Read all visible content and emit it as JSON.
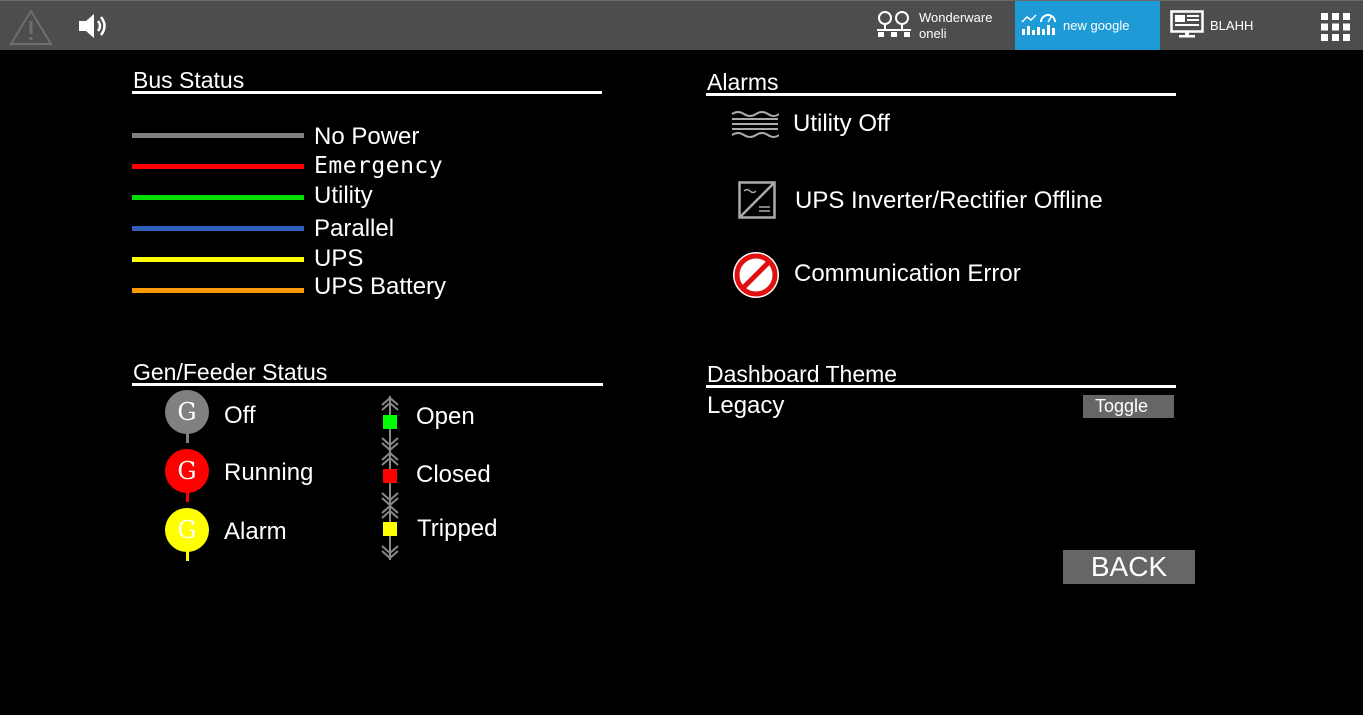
{
  "topbar": {
    "alarm_icon": "warning-triangle-icon",
    "speaker_icon": "speaker-icon",
    "items": [
      {
        "line1": "Wonderware",
        "line2": "oneli",
        "icon": "network-icon"
      },
      {
        "label": "new google",
        "icon": "dashboard-chart-icon",
        "active_color": "#1e9bd7"
      },
      {
        "label": "BLAHH",
        "icon": "monitor-icon"
      }
    ],
    "grid_icon": "app-grid-icon"
  },
  "bus_status": {
    "title": "Bus Status",
    "items": [
      {
        "label": "No Power",
        "color": "#808080"
      },
      {
        "label": "Emergency",
        "color": "#ff0000"
      },
      {
        "label": "Utility",
        "color": "#00e000"
      },
      {
        "label": "Parallel",
        "color": "#2f5fb8"
      },
      {
        "label": "UPS",
        "color": "#ffff00"
      },
      {
        "label": "UPS Battery",
        "color": "#ff9900"
      }
    ]
  },
  "alarms": {
    "title": "Alarms",
    "items": [
      {
        "label": "Utility Off",
        "icon": "utility-off-icon"
      },
      {
        "label": "UPS Inverter/Rectifier Offline",
        "icon": "ups-inverter-icon"
      },
      {
        "label": "Communication Error",
        "icon": "communication-error-icon"
      }
    ]
  },
  "gen_feeder": {
    "title": "Gen/Feeder Status",
    "generators": [
      {
        "letter": "G",
        "label": "Off",
        "color": "#808080"
      },
      {
        "letter": "G",
        "label": "Running",
        "color": "#ff0000"
      },
      {
        "letter": "G",
        "label": "Alarm",
        "color": "#ffff00"
      }
    ],
    "breakers": [
      {
        "label": "Open",
        "color": "#00ff00"
      },
      {
        "label": "Closed",
        "color": "#ff0000"
      },
      {
        "label": "Tripped",
        "color": "#ffff00"
      }
    ]
  },
  "theme": {
    "title": "Dashboard Theme",
    "current": "Legacy",
    "toggle_label": "Toggle"
  },
  "back_label": "BACK"
}
